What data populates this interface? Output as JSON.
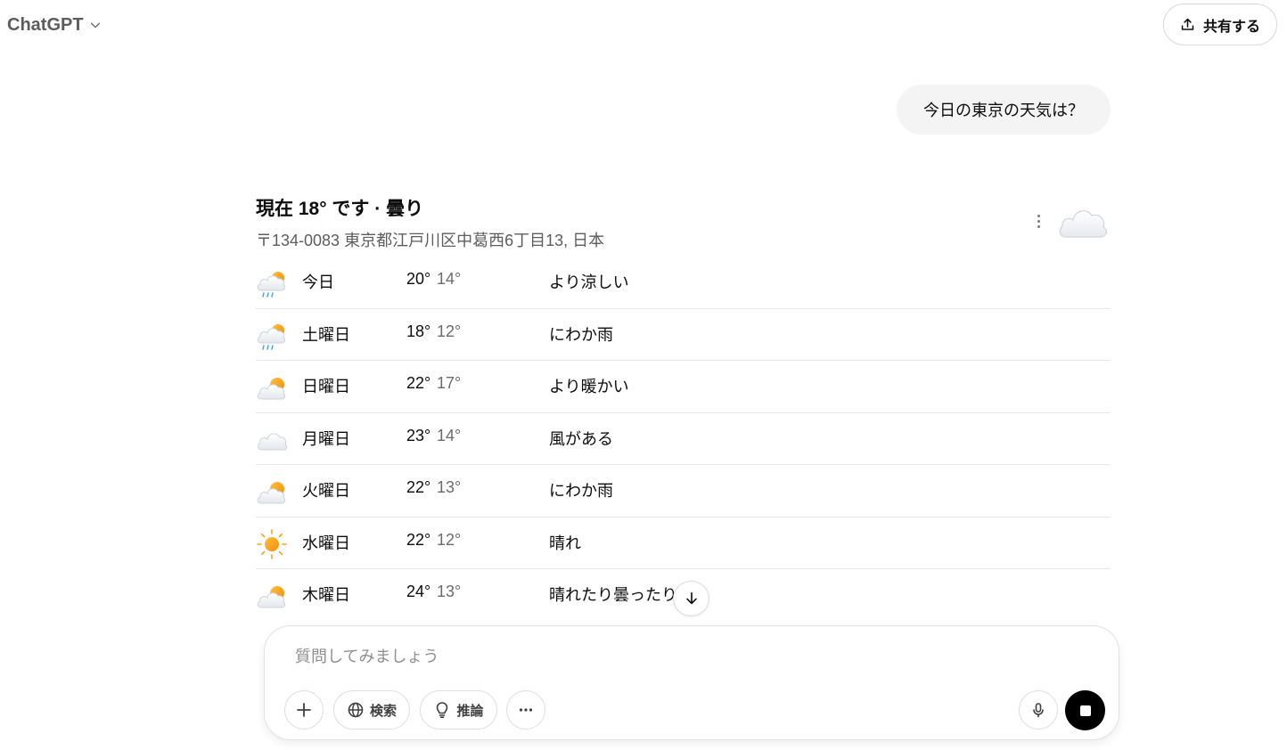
{
  "header": {
    "model_name": "ChatGPT",
    "share_label": "共有する"
  },
  "conversation": {
    "user_message": "今日の東京の天気は？"
  },
  "weather": {
    "title": "現在 18° です · 曇り",
    "address": "〒134-0083 東京都江戸川区中葛西6丁目13, 日本",
    "current_icon": "cloud-icon",
    "forecast": [
      {
        "day": "今日",
        "high": "20°",
        "low": "14°",
        "description": "より涼しい",
        "icon": "rain-sun-cloud-icon"
      },
      {
        "day": "土曜日",
        "high": "18°",
        "low": "12°",
        "description": "にわか雨",
        "icon": "rain-sun-cloud-icon"
      },
      {
        "day": "日曜日",
        "high": "22°",
        "low": "17°",
        "description": "より暖かい",
        "icon": "partly-cloudy-icon"
      },
      {
        "day": "月曜日",
        "high": "23°",
        "low": "14°",
        "description": "風がある",
        "icon": "cloud-icon"
      },
      {
        "day": "火曜日",
        "high": "22°",
        "low": "13°",
        "description": "にわか雨",
        "icon": "partly-cloudy-icon"
      },
      {
        "day": "水曜日",
        "high": "22°",
        "low": "12°",
        "description": "晴れ",
        "icon": "sun-icon"
      },
      {
        "day": "木曜日",
        "high": "24°",
        "low": "13°",
        "description": "晴れたり曇ったり",
        "icon": "partly-cloudy-icon"
      }
    ]
  },
  "composer": {
    "placeholder": "質問してみましょう",
    "search_label": "検索",
    "reason_label": "推論"
  },
  "colors": {
    "accent_sun": "#f7a21b",
    "rain_drop": "#3fa9e0",
    "bubble_bg": "#f4f4f4"
  }
}
